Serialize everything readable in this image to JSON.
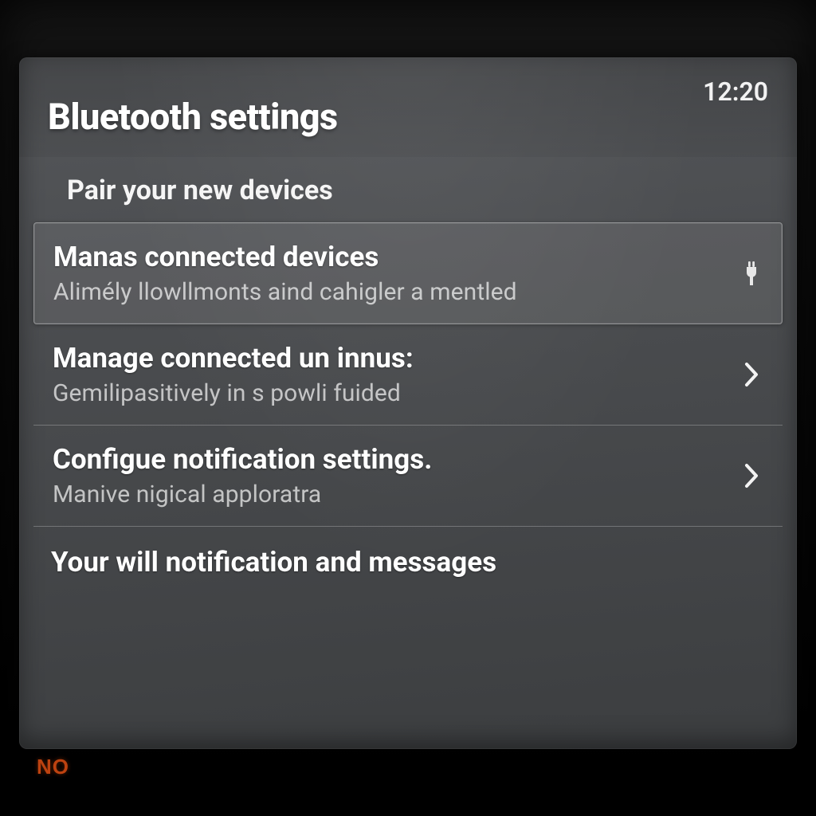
{
  "header": {
    "title": "Bluetooth settings",
    "clock": "12:20"
  },
  "section_label": "Pair your new devices",
  "items": [
    {
      "title": "Manas connected devices",
      "subtitle": "Alimély llowllmonts aind cahigler a mentled",
      "icon": "plug",
      "selected": true
    },
    {
      "title": "Manage connected un innus:",
      "subtitle": "Gemilipasitively in s powli fuided",
      "icon": "chevron",
      "selected": false
    },
    {
      "title": "Configue notification settings.",
      "subtitle": "Manive nigical apploratra",
      "icon": "chevron",
      "selected": false
    }
  ],
  "footer_note": "Your will notification and messages",
  "bottom_label": "NO"
}
